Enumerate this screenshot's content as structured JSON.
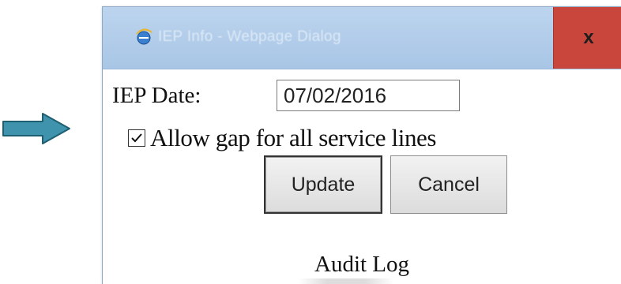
{
  "pointer": {
    "icon": "right-arrow-icon",
    "color": "#3f93ad"
  },
  "dialog": {
    "title_icon": "ie-globe-icon",
    "title": "IEP Info - Webpage Dialog",
    "close_label": "x",
    "close_color": "#c9463d"
  },
  "form": {
    "iep_date_label": "IEP Date:",
    "iep_date_value": "07/02/2016",
    "gap_checkbox_checked": true,
    "gap_checkbox_label": "Allow gap for all service lines",
    "update_label": "Update",
    "cancel_label": "Cancel"
  },
  "audit": {
    "heading": "Audit Log"
  }
}
